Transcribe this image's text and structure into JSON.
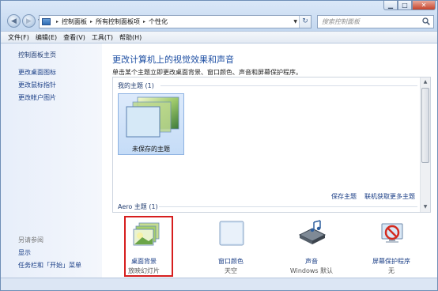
{
  "window": {
    "minimize_glyph": "▁",
    "maximize_glyph": "□",
    "close_glyph": "✕"
  },
  "address": {
    "crumbs": [
      "控制面板",
      "所有控制面板项",
      "个性化"
    ],
    "separator": "▸",
    "refresh_glyph": "↻"
  },
  "search": {
    "placeholder": "搜索控制面板"
  },
  "menu": [
    "文件(F)",
    "编辑(E)",
    "查看(V)",
    "工具(T)",
    "帮助(H)"
  ],
  "sidebar": {
    "home": "控制面板主页",
    "links": [
      "更改桌面图标",
      "更改鼠标指针",
      "更改帐户图片"
    ],
    "see_also_heading": "另请参阅",
    "see_also": [
      "显示",
      "任务栏和「开始」菜单"
    ]
  },
  "main": {
    "title": "更改计算机上的视觉效果和声音",
    "subtitle": "单击某个主题立即更改桌面背景、窗口颜色、声音和屏幕保护程序。",
    "my_themes_label": "我的主题 (1)",
    "unsaved_theme": "未保存的主题",
    "save_theme": "保存主题",
    "get_more_online": "联机获取更多主题",
    "aero_label": "Aero 主题 (1)"
  },
  "bottom": [
    {
      "label": "桌面背景",
      "value": "放映幻灯片"
    },
    {
      "label": "窗口颜色",
      "value": "天空"
    },
    {
      "label": "声音",
      "value": "Windows 默认"
    },
    {
      "label": "屏幕保护程序",
      "value": "无"
    }
  ],
  "colors": {
    "link": "#1a3e86",
    "title": "#1e4fa3",
    "highlight": "#d61e1e"
  },
  "icons": [
    "back-arrow-icon",
    "forward-arrow-icon",
    "control-panel-icon",
    "refresh-icon",
    "search-icon",
    "desktop-background-icon",
    "window-color-icon",
    "sound-icon",
    "screensaver-icon"
  ]
}
